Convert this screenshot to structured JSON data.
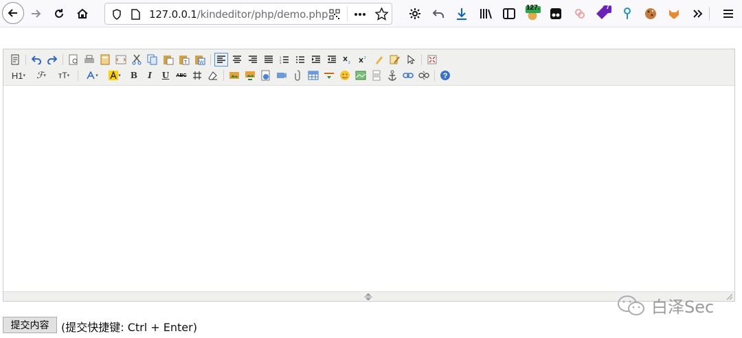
{
  "browser": {
    "url_host": "127.0.0.1",
    "url_path": "/kindeditor/php/demo.php",
    "badges": {
      "ext_count_1": "127.",
      "ext_count_2": "7"
    },
    "colors": {
      "download": "#0060df",
      "badge_green": "#2ea44f",
      "badge_purple": "#6b22b8"
    }
  },
  "editor": {
    "toolbar": {
      "heading_label": "H1",
      "font_label": "ℱ",
      "size_label": "ᴛT",
      "bold_label": "B",
      "italic_label": "I",
      "underline_label": "U",
      "strike_label": "ABC"
    },
    "content": ""
  },
  "form": {
    "submit_label": "提交内容",
    "hint": "(提交快捷键: Ctrl + Enter)"
  },
  "watermark": {
    "text": "白泽Sec"
  }
}
